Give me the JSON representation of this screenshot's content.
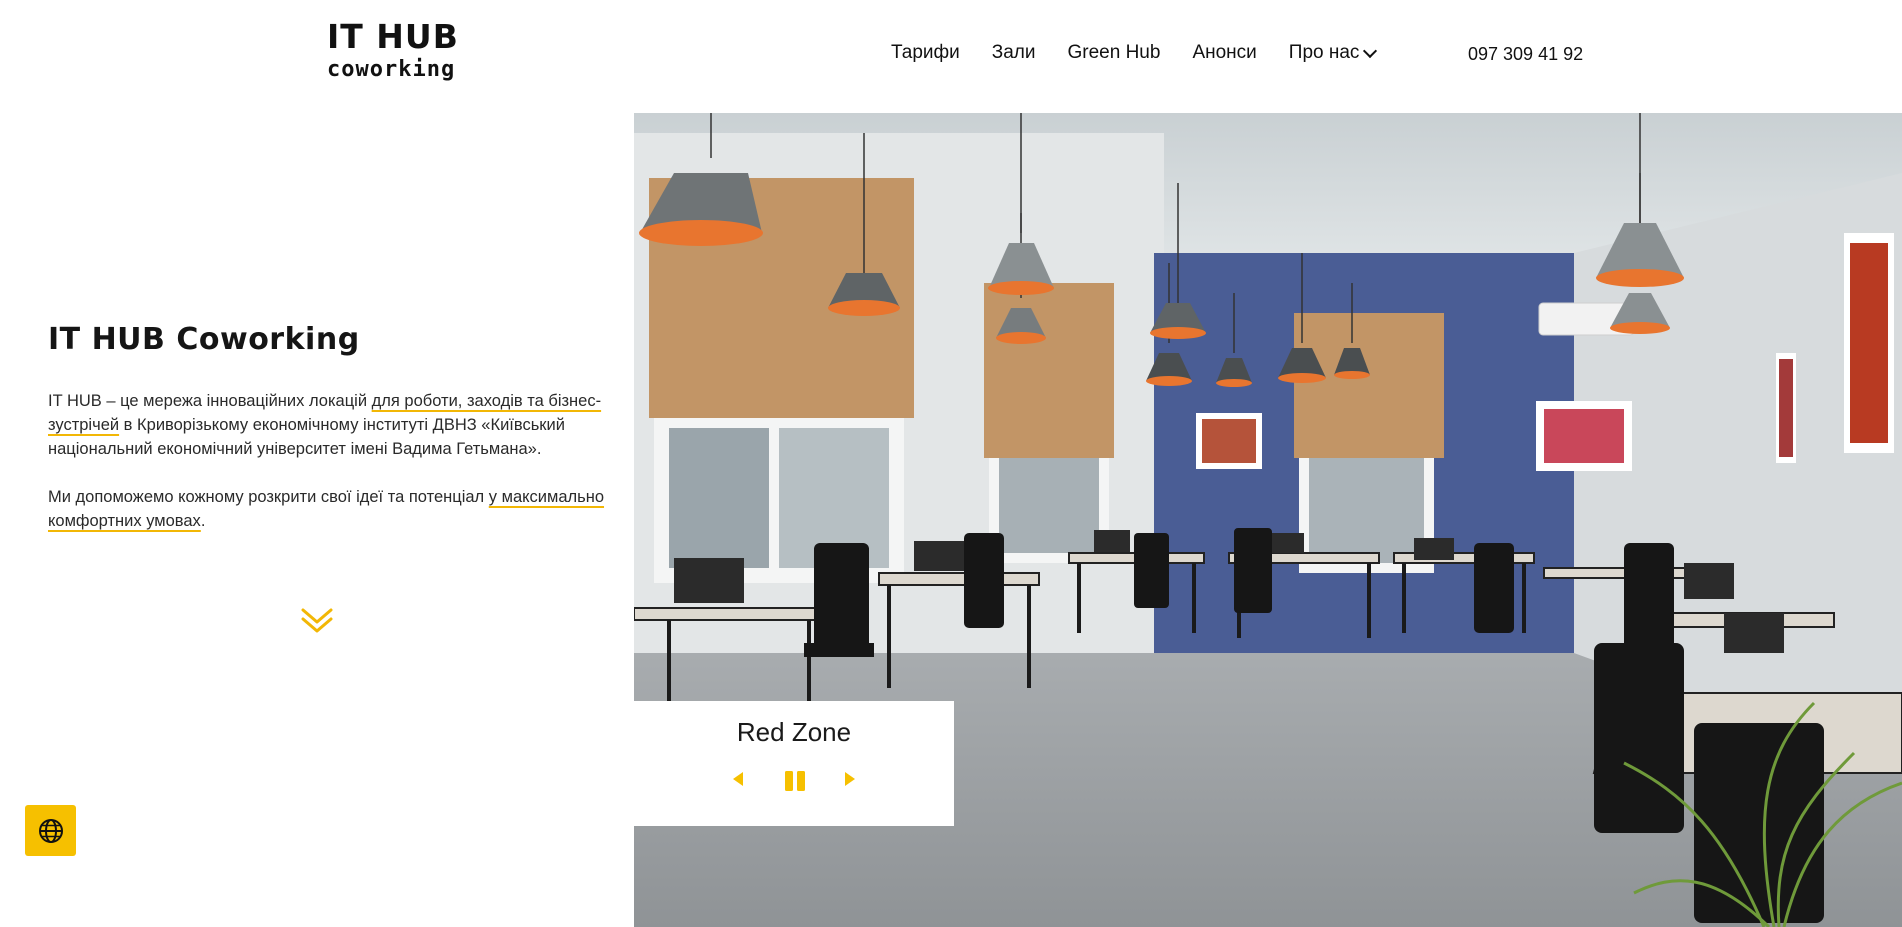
{
  "header": {
    "logo_line1": "IT HUB",
    "logo_line2": "coworking",
    "nav": [
      "Тарифи",
      "Зали",
      "Green Hub",
      "Анонси",
      "Про нас"
    ],
    "phone": "097 309 41 92"
  },
  "hero": {
    "title": "IT HUB Coworking",
    "p1": {
      "a": "IT HUB – це мережа інноваційних локацій ",
      "b": "для роботи, заходів та бізнес-зустрічей",
      "c": " в Криворізькому економічному інституті ДВНЗ «Київський національний економічний університет імені Вадима Гетьмана»."
    },
    "p2": {
      "a": "Ми допоможемо кожному розкрити свої ідеї та потенціал ",
      "b": "у максимально комфортних умовах",
      "c": "."
    }
  },
  "slider": {
    "title": "Red Zone"
  },
  "icons": {
    "down": "chevron-double-down-icon",
    "prev": "prev-arrow-icon",
    "pause": "pause-icon",
    "next": "next-arrow-icon",
    "lang": "globe-icon"
  },
  "colors": {
    "accent": "#f6c000",
    "wall_blue": "#4a5d95",
    "lamp_orange": "#e8752f"
  }
}
